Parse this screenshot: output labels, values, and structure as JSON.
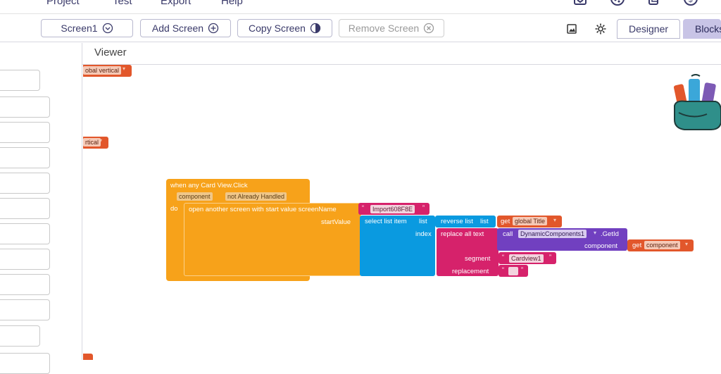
{
  "menu": {
    "items": [
      "Project",
      "Test",
      "Export",
      "Help"
    ]
  },
  "toolbar": {
    "screen_select": "Screen1",
    "add_screen": "Add Screen",
    "copy_screen": "Copy Screen",
    "remove_screen": "Remove Screen",
    "designer": "Designer",
    "blocks": "Blocks"
  },
  "viewer": {
    "title": "Viewer"
  },
  "workspace": {
    "edge_block_1": "obal  vertical",
    "edge_block_2": "rtical",
    "event": {
      "header": "when  any  Card  View.Click",
      "param_1": "component",
      "param_2": "not  Already  Handled",
      "do_label": "do"
    },
    "open_screen": {
      "text": "open  another  screen  with  start  value  screenName",
      "start_value_label": "startValue",
      "screen_name_value": "Import608F8E"
    },
    "select_list": {
      "text": "select  list  item",
      "list_label": "list",
      "index_label": "index"
    },
    "reverse_list": {
      "text": "reverse  list",
      "list_label": "list"
    },
    "get_title": {
      "get": "get",
      "var": "global  Title"
    },
    "replace_all": {
      "text": "replace  all  text",
      "segment_label": "segment",
      "replacement_label": "replacement",
      "segment_value": "Cardview1",
      "replacement_value": ""
    },
    "call": {
      "call": "call",
      "component": "DynamicComponents1",
      "method": ".GetId",
      "component_label": "component"
    },
    "get_component": {
      "get": "get",
      "var": "component"
    }
  },
  "colors": {
    "event": "#f7a21a",
    "variable": "#e2572b",
    "text": "#d6226b",
    "list": "#0a9ae0",
    "component": "#7140c0",
    "accent": "#c8c4e6"
  }
}
